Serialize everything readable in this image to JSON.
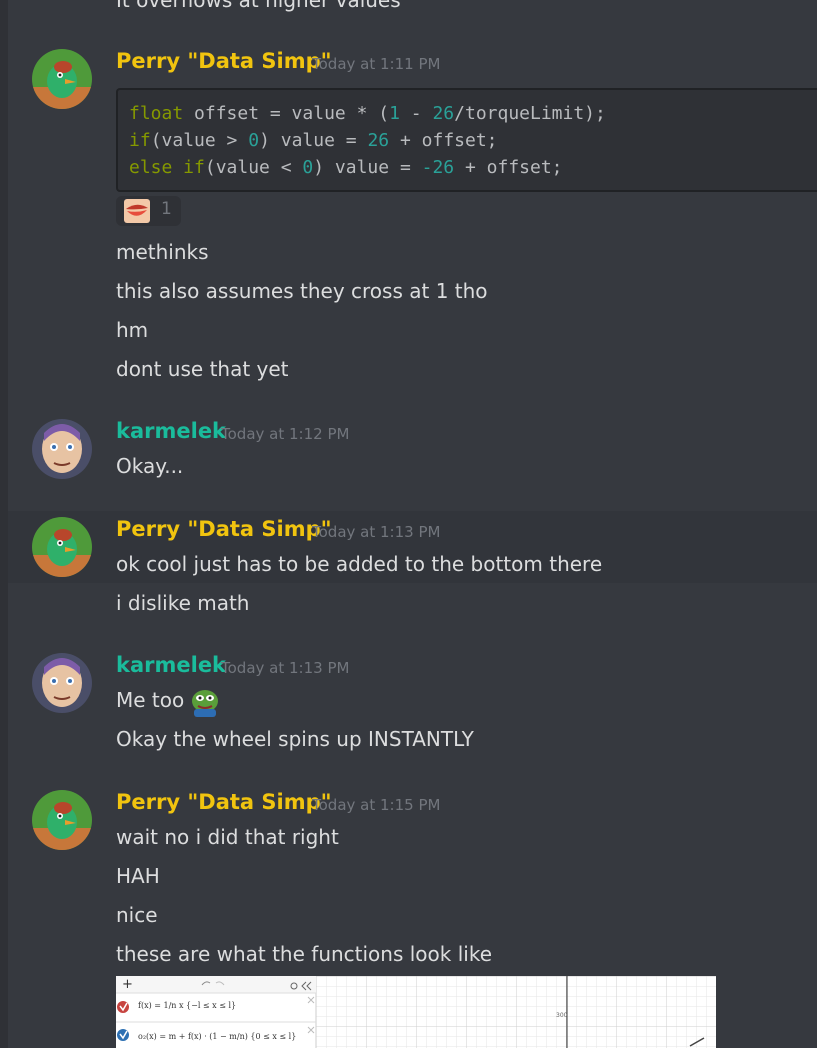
{
  "top_clipped_text": "It overflows at higher values",
  "messages": {
    "m1": {
      "author": "Perry \"Data Simp\"",
      "timestamp": "Today at 1:11 PM",
      "code": {
        "line1": {
          "a": "float",
          "b": " offset = value * (",
          "c": "1",
          "d": " - ",
          "e": "26",
          "f": "/torqueLimit);"
        },
        "line2": {
          "a": "if",
          "b": "(value > ",
          "c": "0",
          "d": ") value = ",
          "e": "26",
          "f": " + offset;"
        },
        "line3": {
          "a": "else if",
          "b": "(value < ",
          "c": "0",
          "d": ") value = ",
          "e": "-26",
          "f": " + offset;"
        }
      },
      "reaction_count": "1",
      "lines": [
        "methinks",
        "this also assumes they cross at 1 tho",
        "hm",
        "dont use that yet"
      ]
    },
    "m2": {
      "author": "karmelek",
      "timestamp": "Today at 1:12 PM",
      "lines": [
        "Okay..."
      ]
    },
    "m3": {
      "author": "Perry \"Data Simp\"",
      "timestamp": "Today at 1:13 PM",
      "lines": [
        "ok cool just has to be added to the bottom there",
        "i dislike math"
      ]
    },
    "m4": {
      "author": "karmelek",
      "timestamp": "Today at 1:13 PM",
      "lines": [
        "Me too",
        "Okay the wheel spins up INSTANTLY"
      ]
    },
    "m5": {
      "author": "Perry \"Data Simp\"",
      "timestamp": "Today at 1:15 PM",
      "lines": [
        "wait no i did that right",
        "HAH",
        "nice",
        "these are what the functions look like"
      ]
    }
  },
  "embed": {
    "toolbar_plus": "+",
    "expr1": "f(x) = 1/n x {−l ≤ x ≤ l}",
    "expr2": "o₂(x) = m + f(x) · (1 − m/n) {0 ≤ x ≤ l}",
    "axis_tick": "300"
  },
  "colors": {
    "perry": "#f1c40f",
    "karmelek": "#1abc9c",
    "background": "#36393f"
  }
}
